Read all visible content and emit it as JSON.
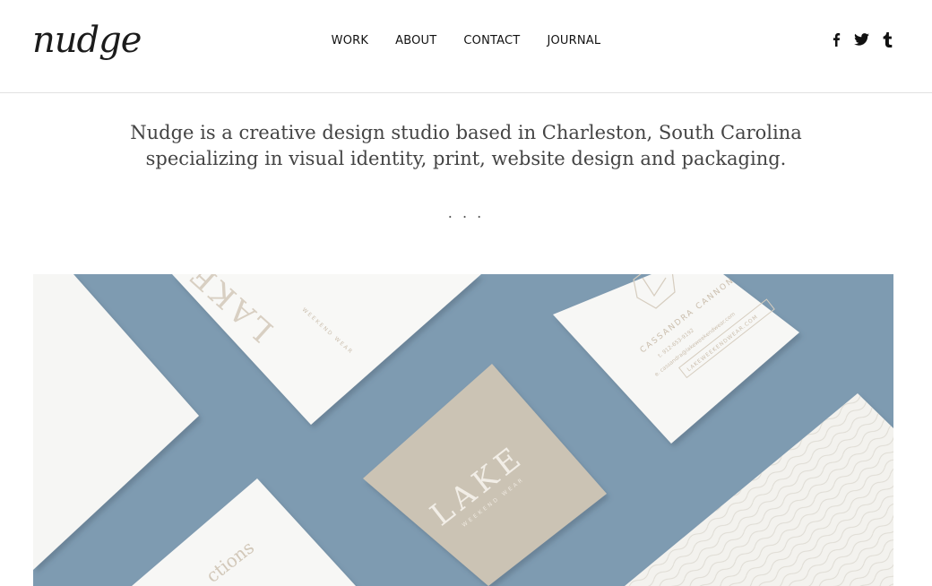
{
  "header": {
    "logo_text": "nudge",
    "nav": [
      {
        "label": "WORK"
      },
      {
        "label": "ABOUT"
      },
      {
        "label": "CONTACT"
      },
      {
        "label": "JOURNAL"
      }
    ],
    "social": [
      {
        "icon": "facebook-icon",
        "glyph": "f"
      },
      {
        "icon": "twitter-icon"
      },
      {
        "icon": "tumblr-icon",
        "glyph": "t"
      }
    ]
  },
  "intro": {
    "line1": "Nudge is a creative design studio based in Charleston, South Carolina",
    "line2": "specializing in visual identity, print, website design and packaging.",
    "separator": ". . ."
  },
  "hero": {
    "background_color": "#7e9bb1",
    "card_beige_text": "LAKE",
    "card_beige_subtext": "WEEKEND WEAR",
    "card_top_text": "LAKE",
    "card_top_subtext": "WEEKEND WEAR",
    "business_card_name": "CASSANDRA CANNON",
    "business_card_phone": "t. 912-653-9192",
    "business_card_email": "e. cassandra@lakeweekendwear.com",
    "business_card_url": "LAKEWEEKENDWEAR.COM",
    "card_bottom_text": "ctions"
  }
}
